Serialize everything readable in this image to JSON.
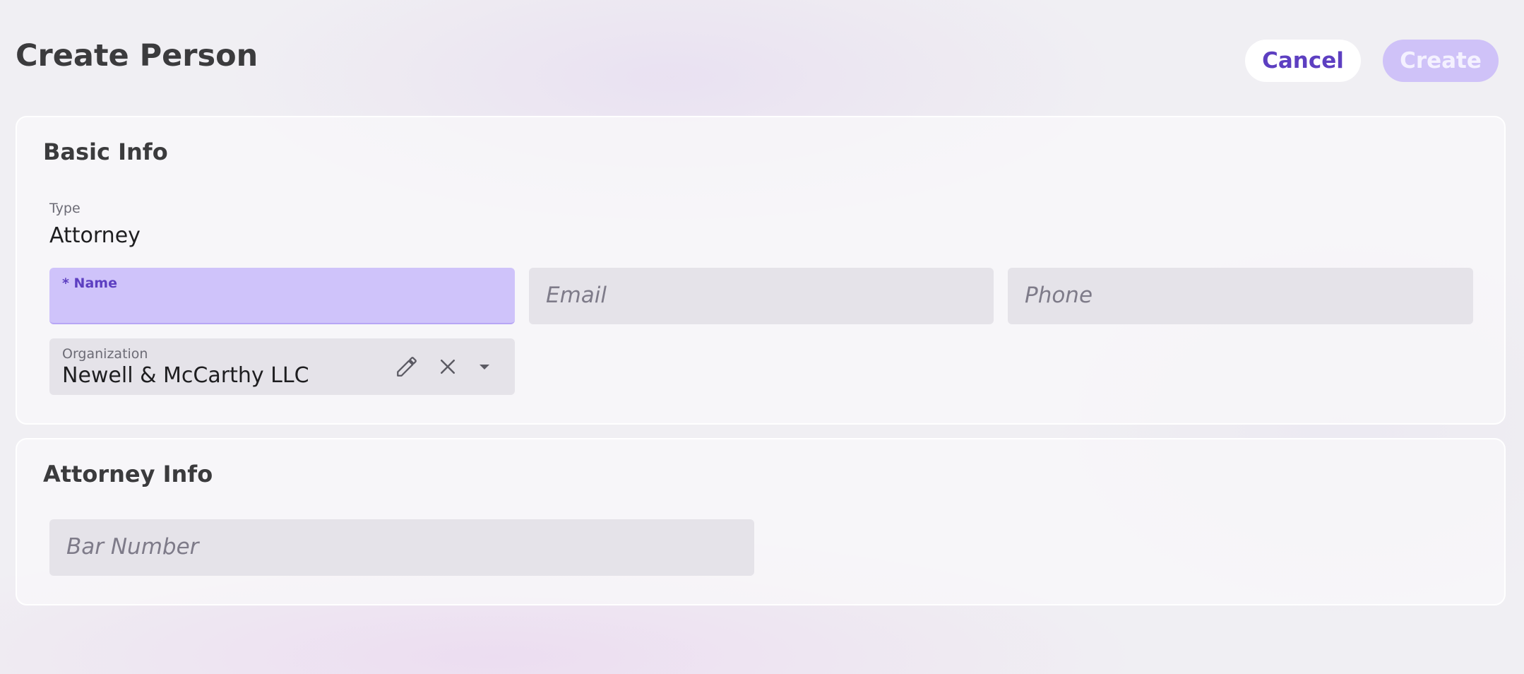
{
  "header": {
    "title": "Create Person",
    "cancel_label": "Cancel",
    "create_label": "Create"
  },
  "basic_info": {
    "title": "Basic Info",
    "type_label": "Type",
    "type_value": "Attorney",
    "name_label": "* Name",
    "name_value": "",
    "email_placeholder": "Email",
    "phone_placeholder": "Phone",
    "organization_label": "Organization",
    "organization_value": "Newell & McCarthy LLC",
    "icons": [
      "pencil-icon",
      "close-icon",
      "caret-down-icon"
    ]
  },
  "attorney_info": {
    "title": "Attorney Info",
    "bar_number_placeholder": "Bar Number"
  },
  "colors": {
    "accent": "#5d3fc1",
    "accent_light": "#cfc3fa",
    "field_bg": "#e5e3e9"
  }
}
